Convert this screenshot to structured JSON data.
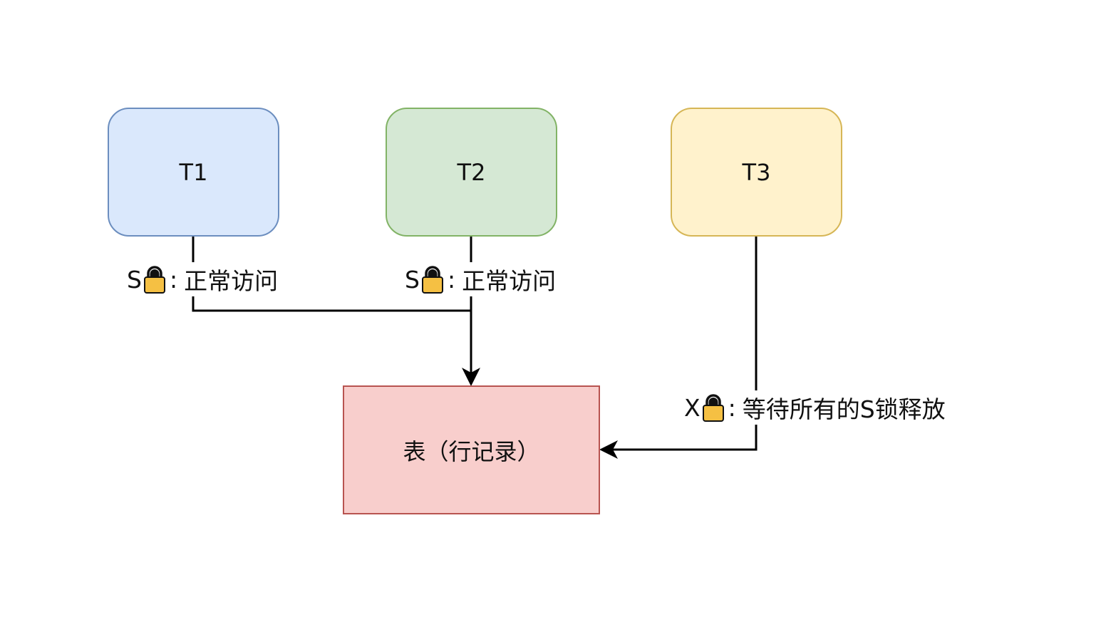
{
  "nodes": {
    "t1": {
      "label": "T1",
      "fill": "#dae8fc",
      "stroke": "#6c8ebf"
    },
    "t2": {
      "label": "T2",
      "fill": "#d5e8d4",
      "stroke": "#82b366"
    },
    "t3": {
      "label": "T3",
      "fill": "#fff2cc",
      "stroke": "#d6b656"
    },
    "table": {
      "label": "表（行记录）",
      "fill": "#f8cecc",
      "stroke": "#b85450"
    }
  },
  "edges": {
    "t1": {
      "mode": "S",
      "separator": ":",
      "text": "正常访问"
    },
    "t2": {
      "mode": "S",
      "separator": ":",
      "text": "正常访问"
    },
    "t3": {
      "mode": "X",
      "separator": ":",
      "text": "等待所有的S锁释放"
    }
  },
  "icons": {
    "lock": "lock-icon",
    "lock_color": "#f5c043"
  }
}
